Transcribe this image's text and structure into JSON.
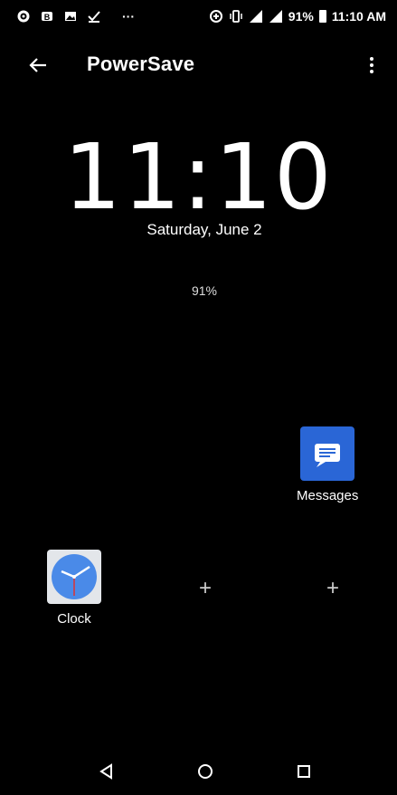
{
  "status_bar": {
    "notification_icons": [
      "gear-icon",
      "b-app-icon",
      "image-icon",
      "checkmark-icon"
    ],
    "overflow": "···",
    "battery_percent": "91%",
    "time": "11:10 AM"
  },
  "app_bar": {
    "title": "PowerSave"
  },
  "clock": {
    "time": "11:10",
    "date": "Saturday, June 2",
    "battery": "91%"
  },
  "apps": [
    {
      "label": "Messages",
      "icon": "messages-icon"
    },
    {
      "label": "Clock",
      "icon": "clock-icon"
    }
  ],
  "add_slots": [
    "+",
    "+"
  ],
  "colors": {
    "background": "#000000",
    "messages_blue": "#2a66d6",
    "clock_blue": "#4a8ae8"
  }
}
